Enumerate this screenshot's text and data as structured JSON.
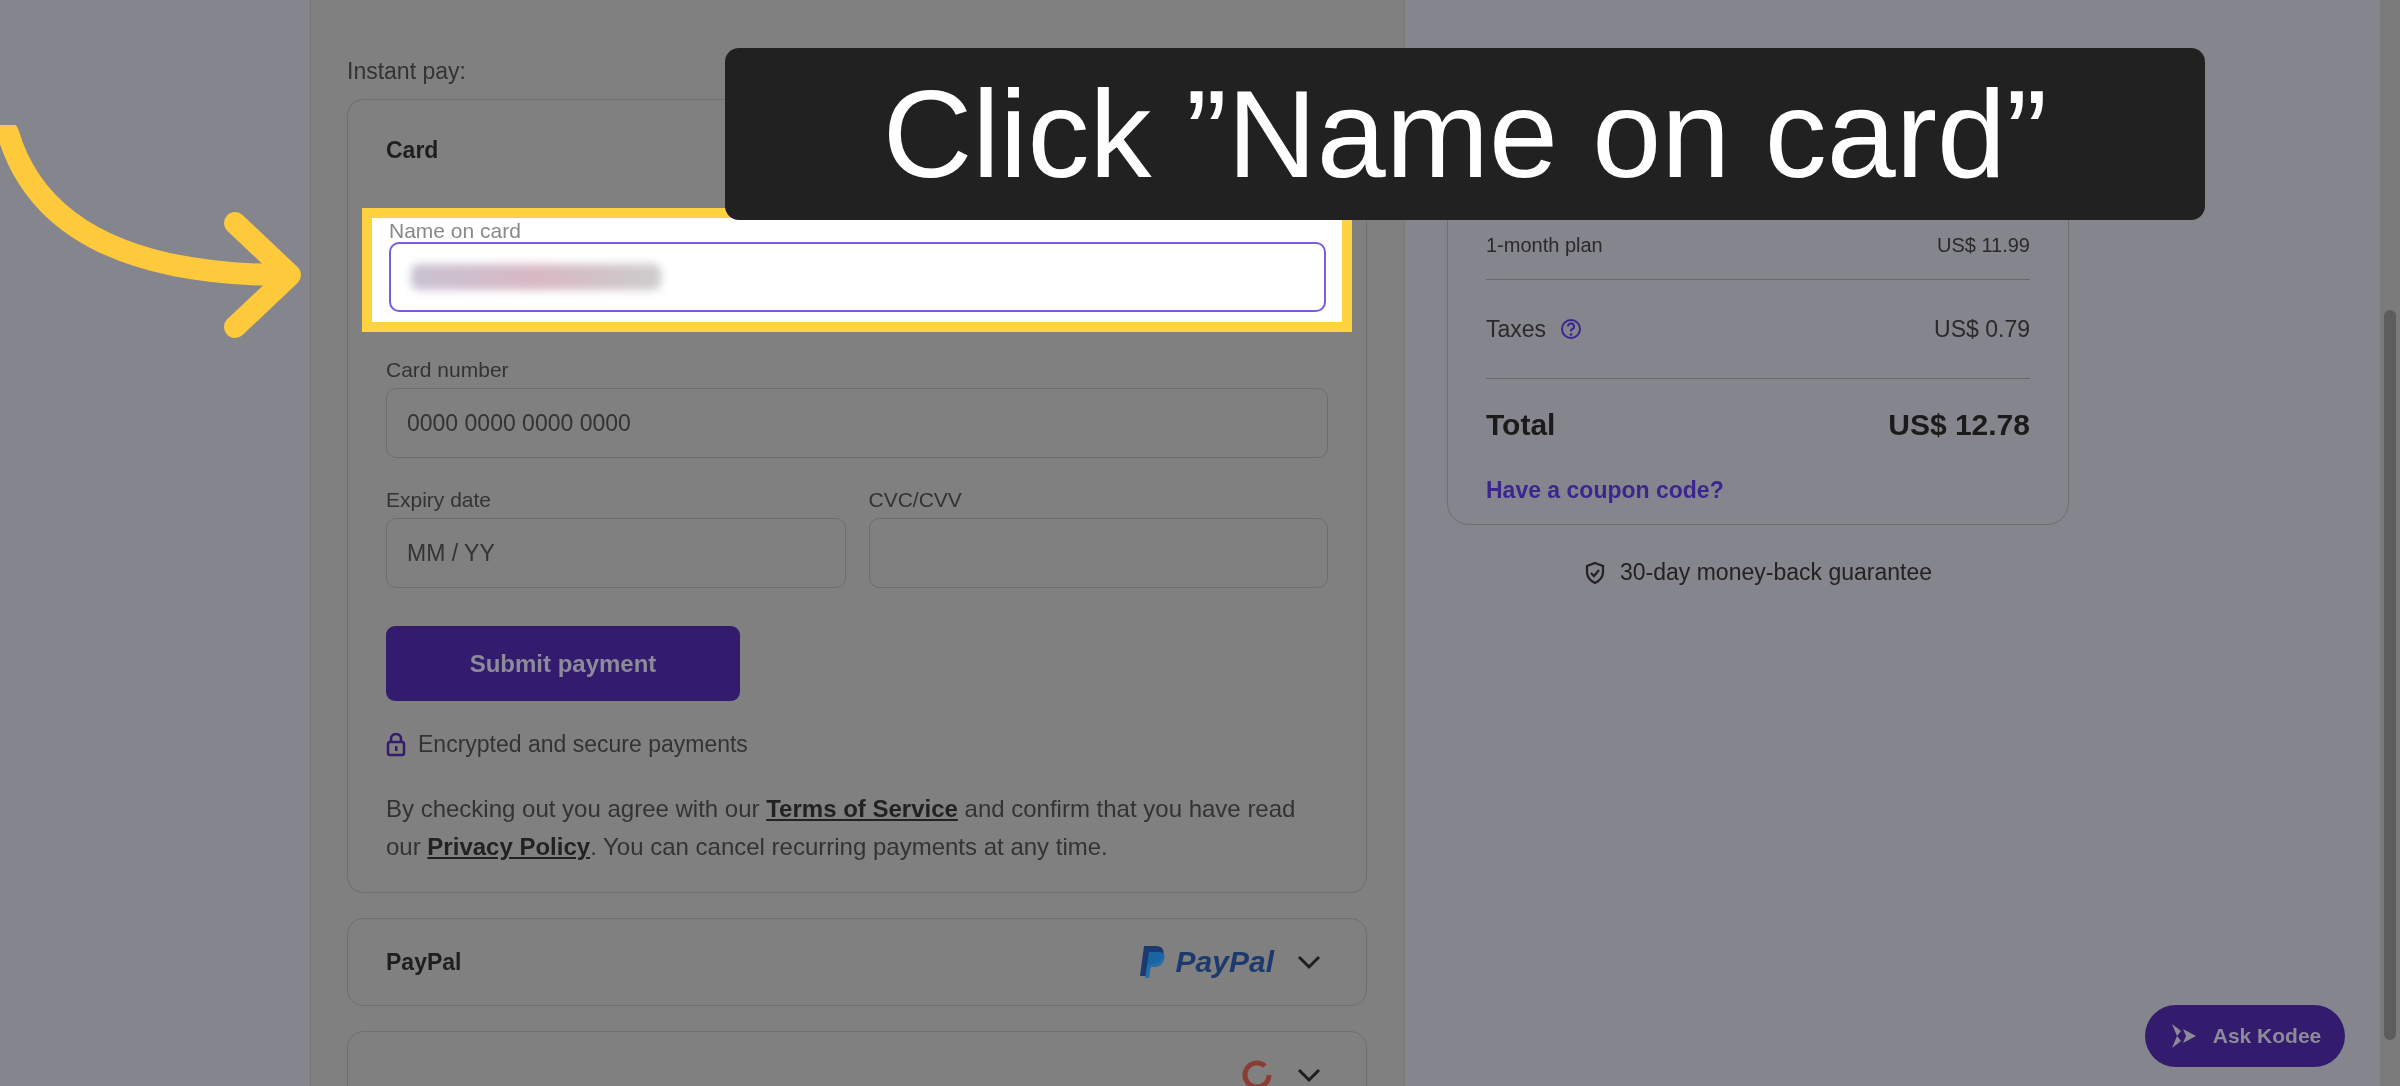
{
  "banner": {
    "text": "Click ”Name on card”"
  },
  "instant_pay_label": "Instant pay:",
  "card_method": {
    "title": "Card",
    "name_field": {
      "label": "Name on card",
      "highlighted": true,
      "redacted": true
    },
    "card_number_field": {
      "label": "Card number",
      "placeholder": "0000 0000 0000 0000"
    },
    "expiry_field": {
      "label": "Expiry date",
      "placeholder": "MM / YY"
    },
    "cvc_field": {
      "label": "CVC/CVV"
    },
    "submit_button": "Submit payment",
    "secure_note": "Encrypted and secure payments",
    "legal_text": [
      {
        "kind": "text",
        "text": "By checking out you agree with our "
      },
      {
        "kind": "link",
        "text": "Terms of Service"
      },
      {
        "kind": "text",
        "text": " and confirm that you have read our "
      },
      {
        "kind": "link",
        "text": "Privacy Policy"
      },
      {
        "kind": "text",
        "text": ". You can cancel recurring payments at any time."
      }
    ]
  },
  "other_methods": [
    {
      "name": "PayPal",
      "kind": "paypal",
      "logo_text": "PayPal",
      "expanded": false
    },
    {
      "kind": "google",
      "expanded": false
    }
  ],
  "summary": {
    "lines": [
      {
        "label": "1-month plan",
        "amount": "US$ 11.99",
        "info": false
      },
      {
        "label": "Taxes",
        "amount": "US$ 0.79",
        "info": true
      }
    ],
    "total": {
      "label": "Total",
      "amount": "US$ 12.78"
    },
    "coupon_link": "Have a coupon code?"
  },
  "guarantee": "30-day money-back guarantee",
  "chat_button": "Ask Kodee"
}
